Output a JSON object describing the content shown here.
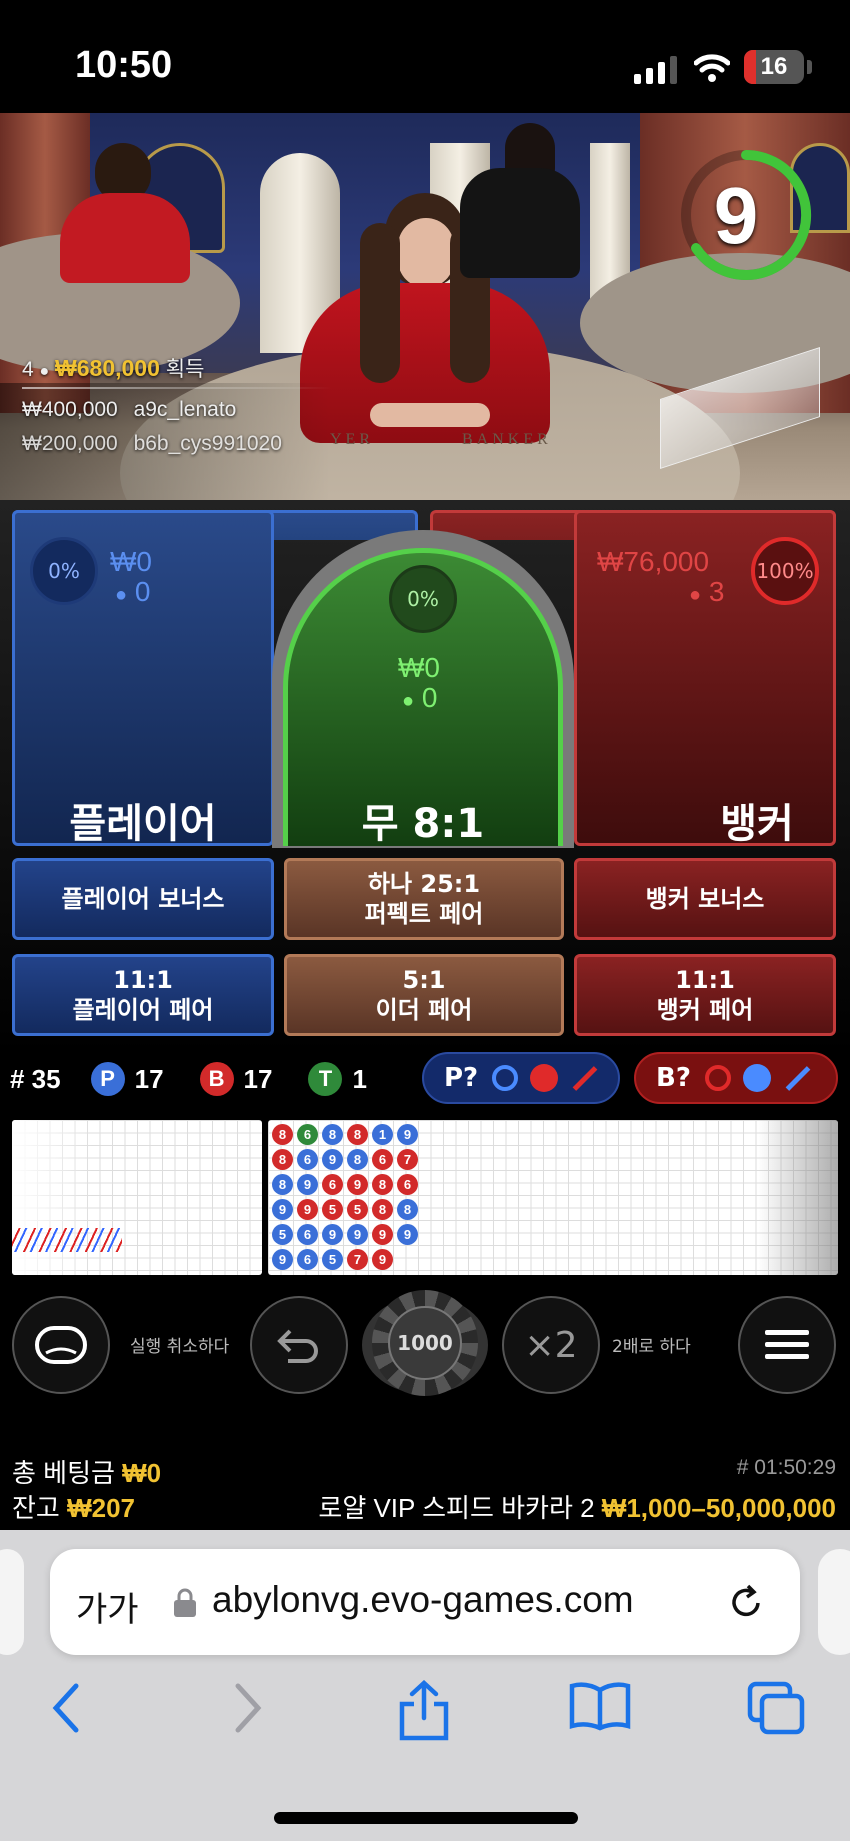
{
  "status_bar": {
    "time": "10:50",
    "battery": "16"
  },
  "video": {
    "timer": "9",
    "win_summary": {
      "count": "4",
      "amount": "₩680,000",
      "label": "획득"
    },
    "winners": [
      {
        "amount": "₩400,000",
        "name": "a9c_lenato"
      },
      {
        "amount": "₩200,000",
        "name": "b6b_cys991020"
      }
    ],
    "table_text_left": "YER",
    "table_text_right": "BANKER"
  },
  "bets": {
    "player": {
      "label": "플레이어",
      "percent": "0%",
      "amount": "₩0",
      "players": "0"
    },
    "tie": {
      "label": "무 8:1",
      "percent": "0%",
      "amount": "₩0",
      "players": "0"
    },
    "banker": {
      "label": "뱅커",
      "percent": "100%",
      "amount": "₩76,000",
      "players": "3"
    }
  },
  "side_bets": [
    {
      "line1": "플레이어 보너스",
      "line2": ""
    },
    {
      "line1": "하나 25:1",
      "line2": "퍼펙트 페어"
    },
    {
      "line1": "뱅커 보너스",
      "line2": ""
    },
    {
      "line1": "11:1",
      "line2": "플레이어 페어"
    },
    {
      "line1": "5:1",
      "line2": "이더 페어"
    },
    {
      "line1": "11:1",
      "line2": "뱅커 페어"
    }
  ],
  "stats": {
    "round_label": "# 35",
    "player_letter": "P",
    "player_count": "17",
    "banker_letter": "B",
    "banker_count": "17",
    "tie_letter": "T",
    "tie_count": "1",
    "player_predict": "P?",
    "banker_predict": "B?"
  },
  "bead_road": [
    [
      "8",
      "6",
      "8",
      "8",
      "1",
      "9"
    ],
    [
      "8",
      "6",
      "9",
      "8",
      "6",
      "7"
    ],
    [
      "8",
      "9",
      "6",
      "9",
      "8",
      "6"
    ],
    [
      "9",
      "9",
      "5",
      "5",
      "8",
      "8"
    ],
    [
      "5",
      "6",
      "9",
      "9",
      "9",
      "9"
    ],
    [
      "9",
      "6",
      "5",
      "7",
      "9",
      ""
    ]
  ],
  "bead_colors": [
    [
      "r",
      "g",
      "b",
      "r",
      "b",
      "b"
    ],
    [
      "r",
      "b",
      "b",
      "b",
      "r",
      "r"
    ],
    [
      "b",
      "b",
      "r",
      "r",
      "r",
      "r"
    ],
    [
      "b",
      "r",
      "r",
      "r",
      "r",
      "b"
    ],
    [
      "b",
      "b",
      "b",
      "b",
      "r",
      "b"
    ],
    [
      "b",
      "b",
      "b",
      "r",
      "r",
      ""
    ]
  ],
  "controls": {
    "undo_label": "실행 취소하다",
    "chip_value": "1000",
    "double_symbol": "×2",
    "double_label": "2배로 하다"
  },
  "footer": {
    "total_bet_label": "총 베팅금",
    "total_bet_value": "₩0",
    "balance_label": "잔고",
    "balance_value": "₩207",
    "round_id": "# 01:50:29",
    "table_name": "로얄 VIP 스피드 바카라 2",
    "limits": "₩1,000–50,000,000"
  },
  "browser": {
    "text_size": "가가",
    "url": "abylonvg.evo-games.com"
  },
  "colors": {
    "player": "#2a4a8a",
    "banker": "#8a2222",
    "tie": "#3c8a34",
    "gold": "#f1c232"
  }
}
